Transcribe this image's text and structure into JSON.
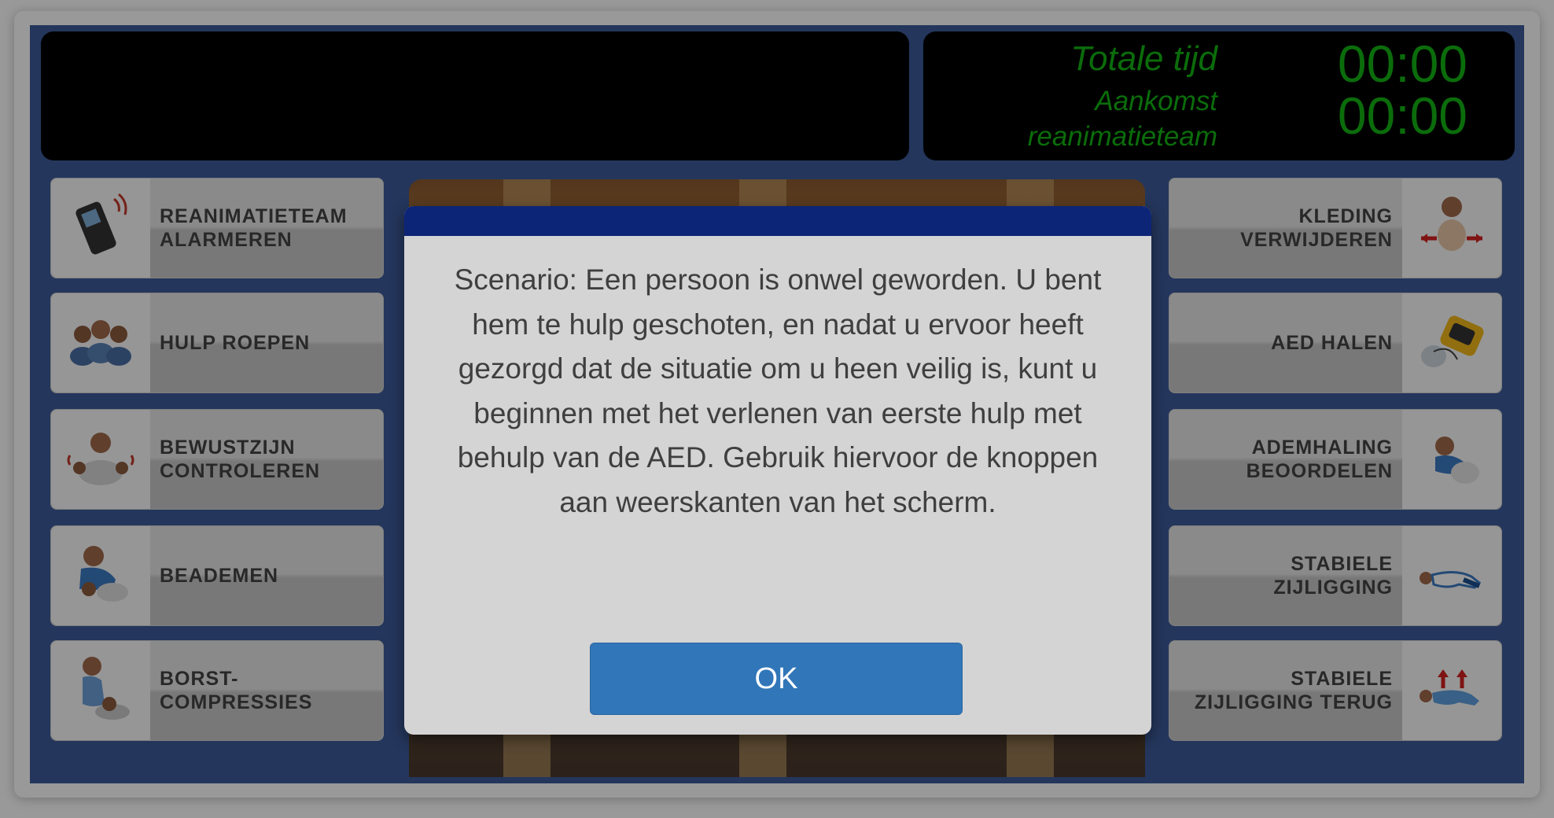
{
  "timers": {
    "total_label": "Totale tijd",
    "total_value": "00:00",
    "arrival_label_line1": "Aankomst",
    "arrival_label_line2": "reanimatieteam",
    "arrival_value": "00:00"
  },
  "left_actions": [
    {
      "label": "REANIMATIETEAM\nALARMEREN",
      "icon": "mobile-phone-icon"
    },
    {
      "label": "HULP ROEPEN",
      "icon": "group-of-people-icon"
    },
    {
      "label": "BEWUSTZIJN\nCONTROLEREN",
      "icon": "shake-shoulders-icon"
    },
    {
      "label": "BEADEMEN",
      "icon": "rescue-breath-icon"
    },
    {
      "label": "BORST-\nCOMPRESSIES",
      "icon": "chest-compression-icon"
    }
  ],
  "right_actions": [
    {
      "label": "KLEDING\nVERWIJDEREN",
      "icon": "remove-clothing-icon"
    },
    {
      "label": "AED HALEN",
      "icon": "aed-device-icon"
    },
    {
      "label": "ADEMHALING\nBEOORDELEN",
      "icon": "check-breathing-icon"
    },
    {
      "label": "STABIELE\nZIJLIGGING",
      "icon": "recovery-position-icon"
    },
    {
      "label": "STABIELE\nZIJLIGGING TERUG",
      "icon": "recovery-position-reverse-icon"
    }
  ],
  "dialog": {
    "text": "Scenario: Een persoon is onwel geworden. U bent hem te hulp geschoten, en nadat u ervoor heeft gezorgd dat de situatie om u heen veilig is, kunt u beginnen met het verlenen van eerste hulp met behulp van de AED. Gebruik hiervoor de knoppen aan weerskanten van het scherm.",
    "ok_label": "OK"
  },
  "colors": {
    "timer_green": "#13b513",
    "dialog_header": "#0d2577",
    "ok_button": "#3176b8",
    "stage_blue": "#3c5a99"
  }
}
